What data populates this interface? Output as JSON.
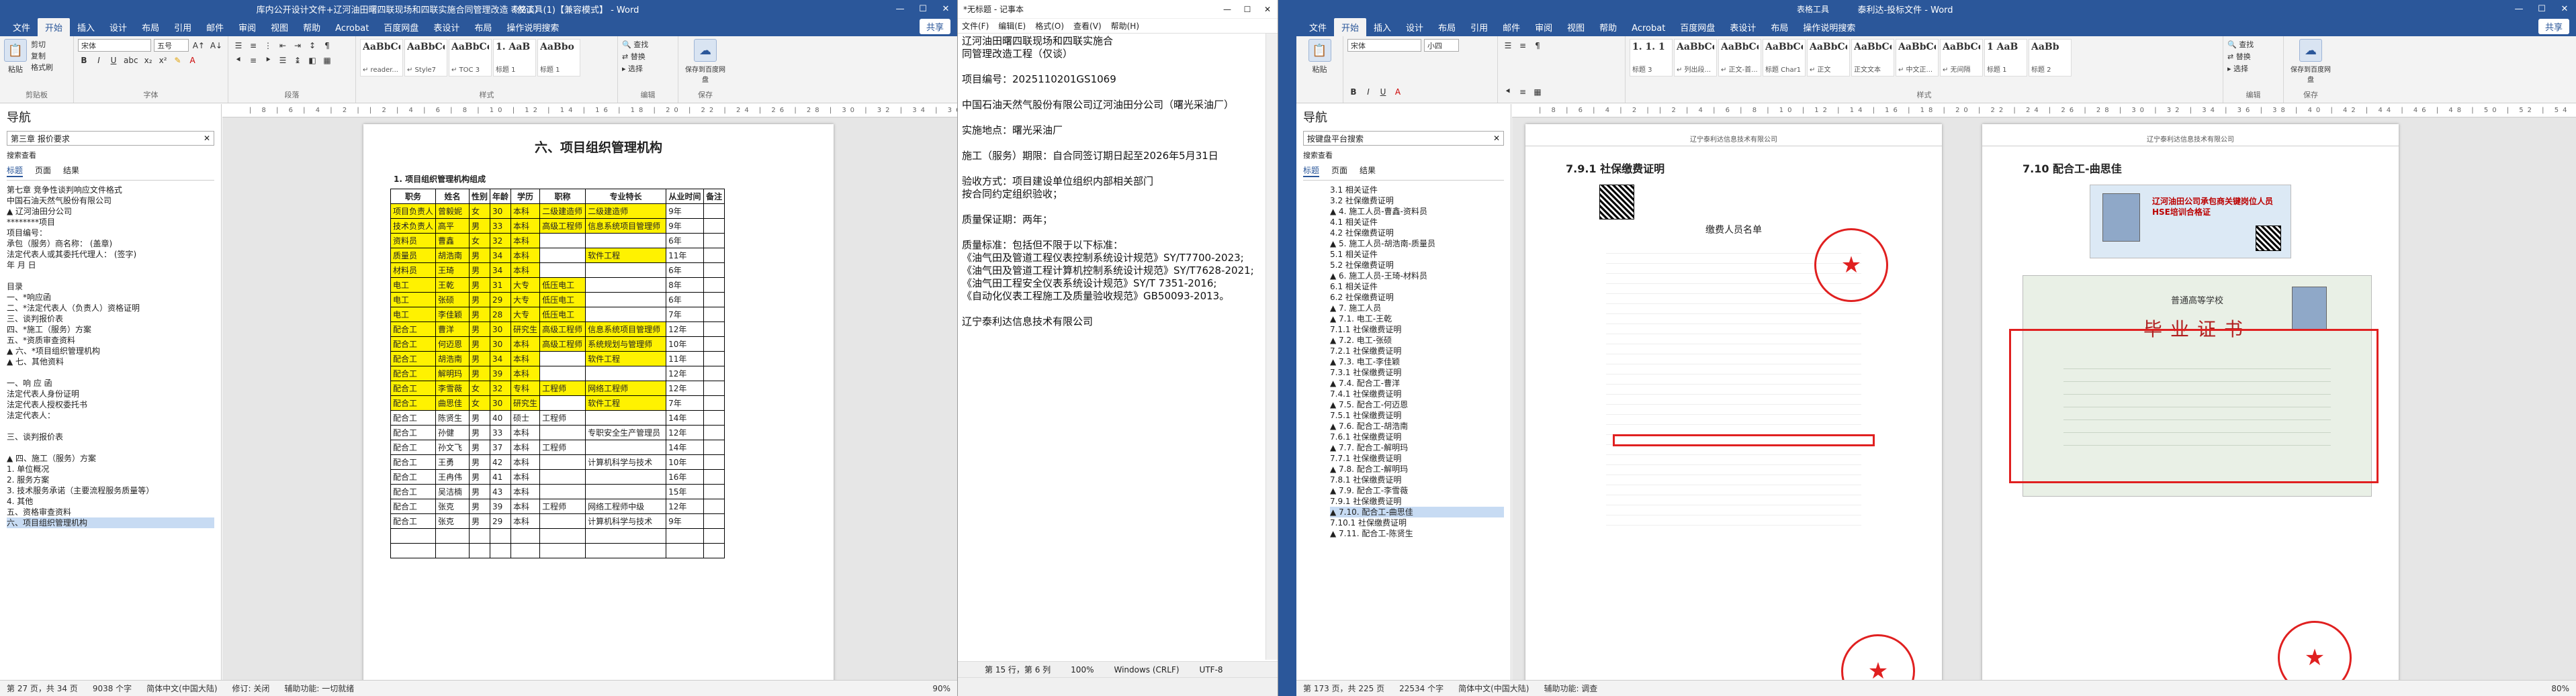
{
  "left_word": {
    "title": "库内公开设计文件+辽河油田曙四联现场和四联实施合同管理改造（仅谈）(1)【兼容模式】 - Word",
    "tool_title": "表格工具",
    "tabs": [
      "文件",
      "开始",
      "插入",
      "设计",
      "布局",
      "引用",
      "邮件",
      "审阅",
      "视图",
      "帮助",
      "Acrobat",
      "百度网盘",
      "表设计",
      "布局",
      "操作说明搜索",
      "共享"
    ],
    "ribbon": {
      "paste": "粘贴",
      "cut": "剪切",
      "copy": "复制",
      "format_painter": "格式刷",
      "clipboard": "剪贴板",
      "font_name": "宋体",
      "font_size": "五号",
      "font": "字体",
      "paragraph": "段落",
      "styles": [
        {
          "s": "AaBbCcDı",
          "n": "↵ reader..."
        },
        {
          "s": "AaBbCcDı",
          "n": "↵ Style7"
        },
        {
          "s": "AaBbCcDı",
          "n": "↵ TOC 3"
        },
        {
          "s": "1. AaB",
          "n": "标题 1"
        },
        {
          "s": "AaBbo",
          "n": "标题 1"
        }
      ],
      "styles_label": "样式",
      "find": "查找",
      "replace": "替换",
      "select": "选择",
      "editing": "编辑",
      "save_baidu": "保存到百度网盘",
      "save_label": "保存"
    },
    "nav": {
      "title": "导航",
      "search": "第三章 报价要求",
      "results": "搜索查看",
      "tabs": [
        "标题",
        "页面",
        "结果"
      ],
      "items": [
        "第七章 竞争性谈判响应文件格式",
        "中国石油天然气股份有限公司",
        "▲ 辽河油田分公司",
        "********项目",
        "项目编号：",
        "承包（服务）商名称：          (盖章)",
        "法定代表人或其委托代理人：        (签字)",
        "年 月 日",
        "",
        "目录",
        "一、*响应函",
        "二、*法定代表人（负责人）资格证明",
        "三、谈判报价表",
        "四、*施工（服务）方案",
        "五、*资质审查资料",
        "▲ 六、*项目组织管理机构",
        "▲ 七、其他资料",
        "",
        "一、响 应 函",
        "法定代表人身份证明",
        "法定代表人授权委托书",
        "法定代表人：",
        "",
        "三、谈判报价表",
        "",
        "▲ 四、施工（服务）方案",
        "1. 单位概况",
        "2. 服务方案",
        "3. 技术服务承诺（主要流程服务质量等）",
        "4. 其他",
        "五、资格审查资料",
        "六、项目组织管理机构"
      ],
      "selected": 31
    },
    "ruler": "| 8 | 6 | 4 | 2 | | 2 | 4 | 6 | 8 | 10 | 12 | 14 | 16 | 18 | 20 | 22 | 24 | 26 | 28 | 30 | 32 | 34 | 36 | 38 | 40 | 42 | 44 | 46 |",
    "section_title": "六、项目组织管理机构",
    "table_title": "1. 项目组织管理机构组成",
    "headers": [
      "职务",
      "姓名",
      "性别",
      "年龄",
      "学历",
      "职称",
      "专业特长",
      "从业时间",
      "备注"
    ],
    "rows": [
      [
        "项目负责人",
        "曾毅妮",
        "女",
        "30",
        "本科",
        "二级建造师",
        "二级建造师",
        "9年",
        ""
      ],
      [
        "技术负责人",
        "高平",
        "男",
        "33",
        "本科",
        "高级工程师",
        "信息系统项目管理师",
        "9年",
        ""
      ],
      [
        "资料员",
        "曹鑫",
        "女",
        "32",
        "本科",
        "",
        "",
        "6年",
        ""
      ],
      [
        "质量员",
        "胡浩南",
        "男",
        "34",
        "本科",
        "",
        "软件工程",
        "11年",
        ""
      ],
      [
        "材料员",
        "王琦",
        "男",
        "34",
        "本科",
        "",
        "",
        "6年",
        ""
      ],
      [
        "电工",
        "王乾",
        "男",
        "31",
        "大专",
        "低压电工",
        "",
        "8年",
        ""
      ],
      [
        "电工",
        "张硕",
        "男",
        "29",
        "大专",
        "低压电工",
        "",
        "6年",
        ""
      ],
      [
        "电工",
        "李佳颖",
        "男",
        "28",
        "大专",
        "低压电工",
        "",
        "7年",
        ""
      ],
      [
        "配合工",
        "曹洋",
        "男",
        "30",
        "研究生",
        "高级工程师",
        "信息系统项目管理师",
        "12年",
        ""
      ],
      [
        "配合工",
        "何迈恩",
        "男",
        "30",
        "本科",
        "高级工程师",
        "系统规划与管理师",
        "10年",
        ""
      ],
      [
        "配合工",
        "胡浩南",
        "男",
        "34",
        "本科",
        "",
        "软件工程",
        "11年",
        ""
      ],
      [
        "配合工",
        "解明玛",
        "男",
        "39",
        "本科",
        "",
        "",
        "12年",
        ""
      ],
      [
        "配合工",
        "李雪薇",
        "女",
        "32",
        "专科",
        "工程师",
        "网络工程师",
        "12年",
        ""
      ],
      [
        "配合工",
        "曲思佳",
        "女",
        "30",
        "研究生",
        "",
        "软件工程",
        "7年",
        ""
      ],
      [
        "配合工",
        "陈贤生",
        "男",
        "40",
        "硕士",
        "工程师",
        "",
        "14年",
        ""
      ],
      [
        "配合工",
        "孙健",
        "男",
        "33",
        "本科",
        "",
        "专职安全生产管理员",
        "12年",
        ""
      ],
      [
        "配合工",
        "孙文飞",
        "男",
        "37",
        "本科",
        "工程师",
        "",
        "14年",
        ""
      ],
      [
        "配合工",
        "王勇",
        "男",
        "42",
        "本科",
        "",
        "计算机科学与技术",
        "10年",
        ""
      ],
      [
        "配合工",
        "王冉伟",
        "男",
        "41",
        "本科",
        "",
        "",
        "16年",
        ""
      ],
      [
        "配合工",
        "吴洁楠",
        "男",
        "43",
        "本科",
        "",
        "",
        "15年",
        ""
      ],
      [
        "配合工",
        "张克",
        "男",
        "39",
        "本科",
        "工程师",
        "网络工程师中级",
        "12年",
        ""
      ],
      [
        "配合工",
        "张克",
        "男",
        "29",
        "本科",
        "",
        "计算机科学与技术",
        "9年",
        ""
      ],
      [
        "",
        "",
        "",
        "",
        "",
        "",
        "",
        "",
        ""
      ],
      [
        "",
        "",
        "",
        "",
        "",
        "",
        "",
        "",
        ""
      ]
    ],
    "highlight_rows": [
      0,
      1,
      2,
      3,
      4,
      5,
      6,
      7,
      8,
      9,
      10,
      11,
      12,
      13
    ],
    "status": {
      "page": "第 27 页，共 34 页",
      "words": "9038 个字",
      "lang": "简体中文(中国大陆)",
      "track": "修订: 关闭",
      "access": "辅助功能: 一切就绪",
      "zoom": "90%"
    }
  },
  "notepad": {
    "title": "*无标题 - 记事本",
    "menu": [
      "文件(F)",
      "编辑(E)",
      "格式(O)",
      "查看(V)",
      "帮助(H)"
    ],
    "text": "辽河油田曙四联现场和四联实施合\n同管理改造工程（仅谈）\n\n项目编号：2025110201GS1069\n\n中国石油天然气股份有限公司辽河油田分公司（曙光采油厂）\n\n实施地点：曙光采油厂\n\n施工（服务）期限：自合同签订期日起至2026年5月31日\n\n验收方式：项目建设单位组织内部相关部门\n按合同约定组织验收；\n\n质量保证期：两年；\n\n质量标准：包括但不限于以下标准：\n《油气田及管道工程仪表控制系统设计规范》SY/T7700-2023;\n《油气田及管道工程计算机控制系统设计规范》SY/T7628-2021;\n《油气田工程安全仪表系统设计规范》SY/T 7351-2016;\n《自动化仪表工程施工及质量验收规范》GB50093-2013。\n\n辽宁泰利达信息技术有限公司",
    "status": {
      "pos": "第 15 行，第 6 列",
      "zoom": "100%",
      "eol": "Windows (CRLF)",
      "enc": "UTF-8"
    }
  },
  "right_word": {
    "title": "泰利达-投标文件 - Word",
    "tool_title": "表格工具",
    "tabs": [
      "文件",
      "开始",
      "插入",
      "设计",
      "布局",
      "引用",
      "邮件",
      "审阅",
      "视图",
      "帮助",
      "Acrobat",
      "百度网盘",
      "表设计",
      "布局",
      "操作说明搜索",
      "共享"
    ],
    "ribbon": {
      "paste": "粘贴",
      "font_name": "宋体",
      "font_size": "小四",
      "styles_label": "样式",
      "styles": [
        {
          "s": "1. 1. 1",
          "n": "标题 3"
        },
        {
          "s": "AaBbCcD",
          "n": "↵ 列出段..."
        },
        {
          "s": "AaBbCcDı",
          "n": "↵ 正文-首..."
        },
        {
          "s": "AaBbCc",
          "n": "标题 Char1"
        },
        {
          "s": "AaBbCcDd",
          "n": "↵ 正文"
        },
        {
          "s": "AaBbCcDd",
          "n": "正文文本"
        },
        {
          "s": "AaBbCcDı",
          "n": "↵ 中文正..."
        },
        {
          "s": "AaBbCcDı",
          "n": "↵ 无间隔"
        },
        {
          "s": "1 AaB",
          "n": "标题 1"
        },
        {
          "s": "AaBb",
          "n": "标题 2"
        }
      ],
      "find": "查找",
      "replace": "替换",
      "select": "选择",
      "editing": "编辑",
      "save_baidu": "保存到百度网盘",
      "save_label": "保存"
    },
    "nav": {
      "title": "导航",
      "search": "按键盘平台搜索",
      "results": "搜索查看",
      "tabs": [
        "标题",
        "页面",
        "结果"
      ],
      "items": [
        "3.1 相关证件",
        "3.2 社保缴费证明",
        "▲ 4. 施工人员-曹鑫-资料员",
        "4.1 相关证件",
        "4.2 社保缴费证明",
        "▲ 5. 施工人员-胡浩南-质量员",
        "5.1 相关证件",
        "5.2 社保缴费证明",
        "▲ 6. 施工人员-王琦-材料员",
        "6.1 相关证件",
        "6.2 社保缴费证明",
        "▲ 7. 施工人员",
        "▲ 7.1. 电工-王乾",
        "7.1.1 社保缴费证明",
        "▲ 7.2. 电工-张硕",
        "7.2.1 社保缴费证明",
        "▲ 7.3. 电工-李佳颖",
        "7.3.1 社保缴费证明",
        "▲ 7.4. 配合工-曹洋",
        "7.4.1 社保缴费证明",
        "▲ 7.5. 配合工-何迈恩",
        "7.5.1 社保缴费证明",
        "▲ 7.6. 配合工-胡浩南",
        "7.6.1 社保缴费证明",
        "▲ 7.7. 配合工-解明玛",
        "7.7.1 社保缴费证明",
        "▲ 7.8. 配合工-解明玛",
        "7.8.1 社保缴费证明",
        "▲ 7.9. 配合工-李雪薇",
        "7.9.1 社保缴费证明",
        "▲ 7.10. 配合工-曲思佳",
        "7.10.1 社保缴费证明",
        "▲ 7.11. 配合工-陈贤生"
      ],
      "selected": 30
    },
    "ruler": "| 8 | 6 | 4 | 2 | | 2 | 4 | 6 | 8 | 10 | 12 | 14 | 16 | 18 | 20 | 22 | 24 | 26 | 28 | 30 | 32 | 34 | 36 | 38 | 40 | 42 | 44 | 46 | 48 | 50 | 52 | 54 | 56 | 58 | 60 | 62 | 64 | 66 | 68 | 70 | 72 | 74 |",
    "page_a": {
      "header": "辽宁泰利达信息技术有限公司",
      "heading": "7.9.1 社保缴费证明",
      "list_title": "缴费人员名单",
      "rows": [
        "",
        ""
      ]
    },
    "page_b": {
      "header": "辽宁泰利达信息技术有限公司",
      "heading": "7.10 配合工-曲思佳",
      "id_card": "辽河油田公司承包商关键岗位人员HSE培训合格证",
      "school": "普通高等学校",
      "cert_title": "毕业证书"
    },
    "status": {
      "page": "第 173 页，共 225 页",
      "words": "22534 个字",
      "lang": "简体中文(中国大陆)",
      "access": "辅助功能: 调查",
      "zoom": "80%"
    }
  },
  "icons": {
    "close": "✕",
    "min": "—",
    "max": "☐",
    "stamp": "★"
  }
}
